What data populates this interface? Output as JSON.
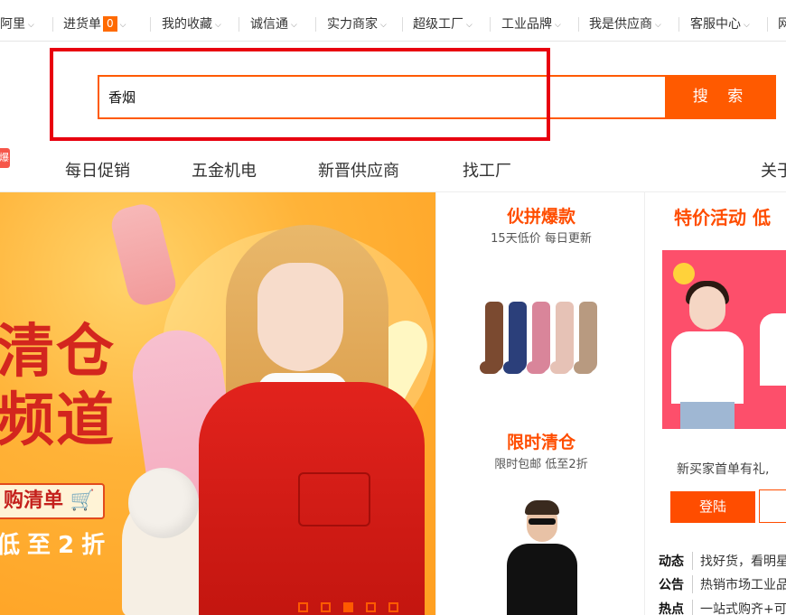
{
  "topnav": {
    "items": [
      {
        "label": "阿里",
        "dropdown": true
      },
      {
        "label": "进货单",
        "badge": "0",
        "dropdown": true
      },
      {
        "label": "我的收藏",
        "dropdown": true
      },
      {
        "label": "诚信通",
        "dropdown": true
      },
      {
        "label": "实力商家",
        "dropdown": true
      },
      {
        "label": "超级工厂",
        "dropdown": true
      },
      {
        "label": "工业品牌",
        "dropdown": true
      },
      {
        "label": "我是供应商",
        "dropdown": true
      },
      {
        "label": "客服中心",
        "dropdown": true
      },
      {
        "label": "网",
        "dropdown": false
      }
    ]
  },
  "search": {
    "query": "香烟",
    "button_label": "搜 索"
  },
  "flag_text": "爆",
  "catnav": {
    "items": [
      "每日促销",
      "五金机电",
      "新晋供应商",
      "找工厂",
      "关于"
    ]
  },
  "banner": {
    "title_line1": "清仓",
    "title_line2": "频道",
    "pill_text": "购清单",
    "promo_text": "低至2折",
    "slide_count": 5,
    "active_slide": 3
  },
  "middle": {
    "sections": [
      {
        "title": "伙拼爆款",
        "subtitle": "15天低价 每日更新"
      },
      {
        "title": "限时清仓",
        "subtitle": "限时包邮 低至2折"
      }
    ]
  },
  "right": {
    "title": "特价活动 低",
    "promo_text": "新买家首单有礼,",
    "login_label": "登陆",
    "info": [
      {
        "label": "动态",
        "text": "找好货，看明星"
      },
      {
        "label": "公告",
        "text": "热销市场工业品"
      },
      {
        "label": "热点",
        "text": "一站式购齐+可"
      }
    ]
  },
  "colors": {
    "accent": "#ff5a00",
    "highlight_frame": "#e8000f",
    "banner_bg": "#ffb338"
  }
}
